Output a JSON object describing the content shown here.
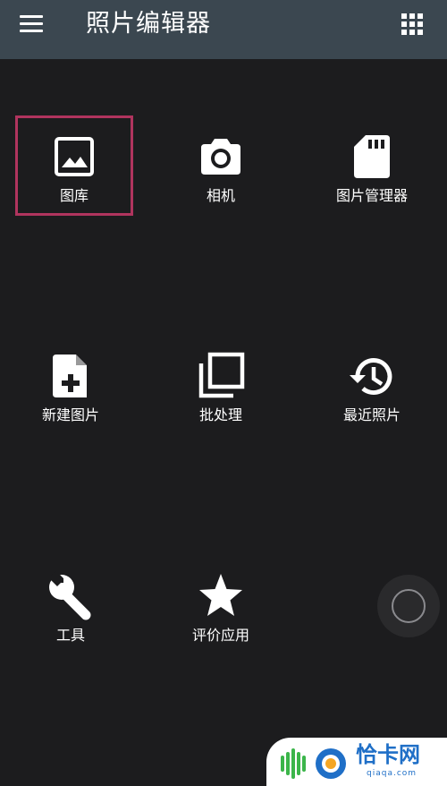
{
  "header": {
    "title": "照片编辑器",
    "menu_icon": "hamburger-menu-icon",
    "apps_icon": "grid-apps-icon"
  },
  "tiles": [
    {
      "label": "图库",
      "icon": "image-icon",
      "selected": true
    },
    {
      "label": "相机",
      "icon": "camera-icon"
    },
    {
      "label": "图片管理器",
      "icon": "sd-card-icon"
    },
    {
      "label": "新建图片",
      "icon": "new-file-plus-icon"
    },
    {
      "label": "批处理",
      "icon": "stacked-pages-icon"
    },
    {
      "label": "最近照片",
      "icon": "history-clock-icon"
    },
    {
      "label": "工具",
      "icon": "wrench-icon"
    },
    {
      "label": "评价应用",
      "icon": "star-icon"
    }
  ],
  "watermark": {
    "text": "恰卡网",
    "sub": "qiaqa.com"
  },
  "colors": {
    "background": "#1c1c1e",
    "appbar": "#3b4750",
    "selection_border": "#b0345e",
    "watermark_blue": "#1f6fc7"
  }
}
